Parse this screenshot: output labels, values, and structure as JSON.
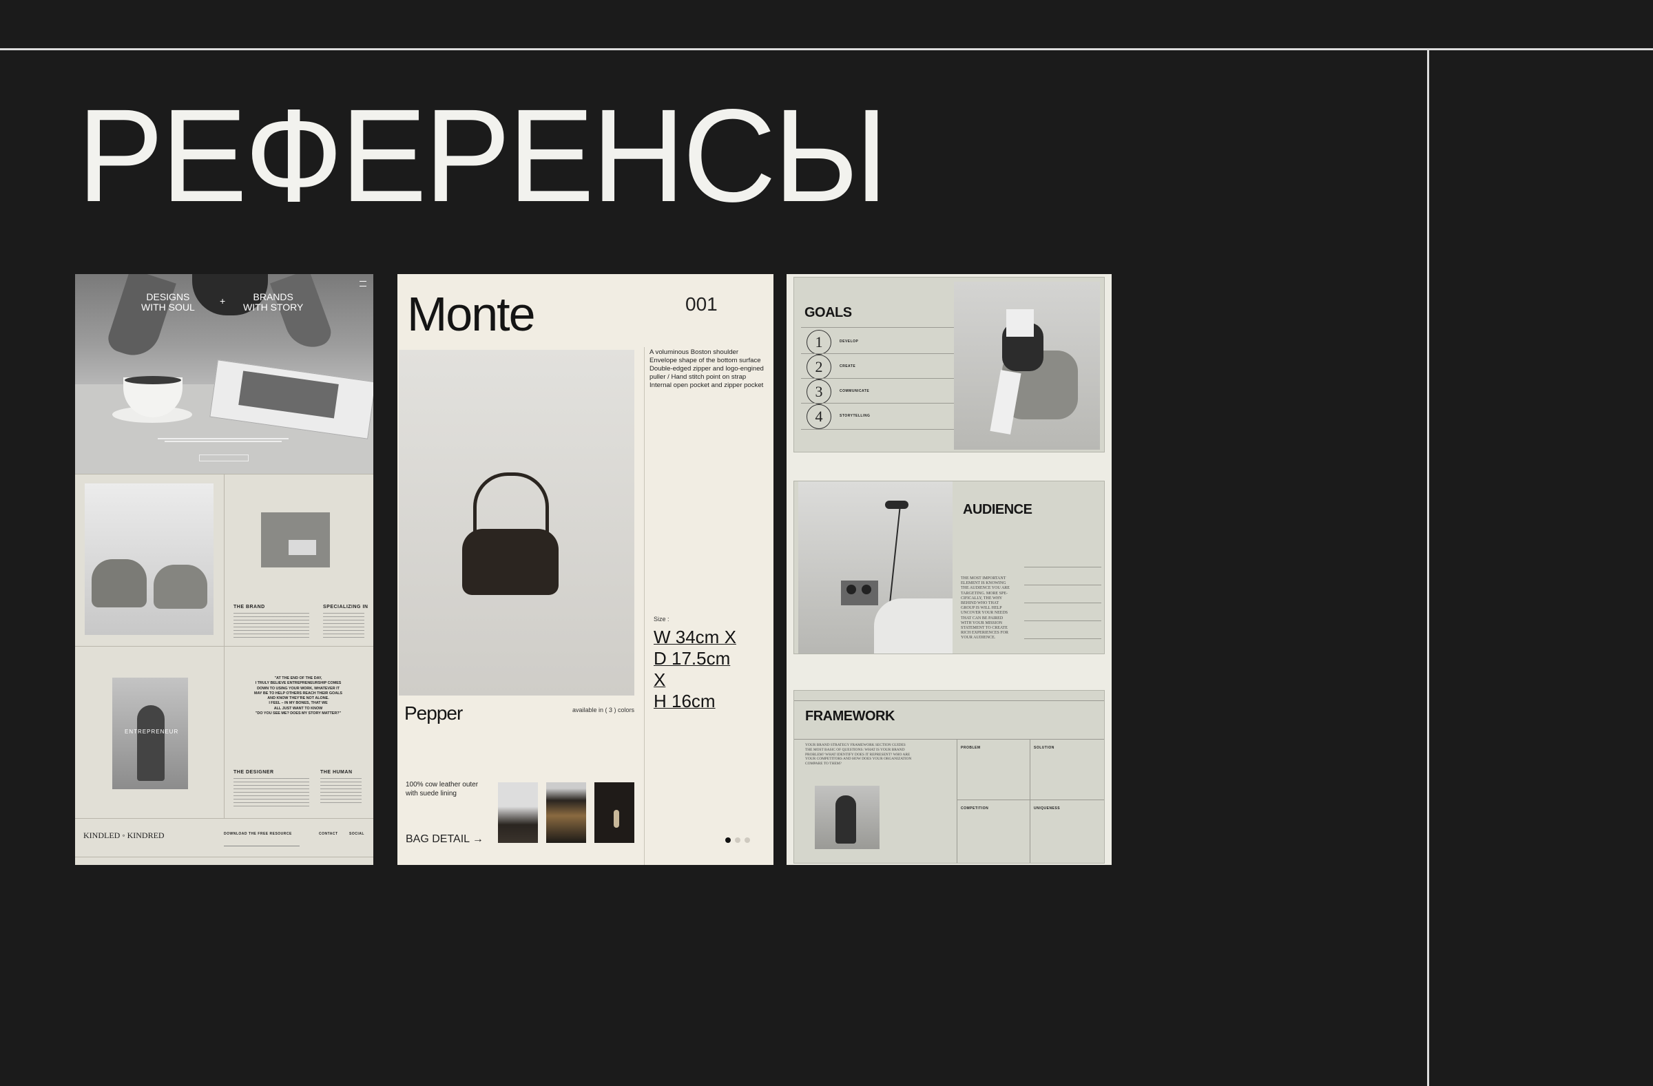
{
  "page": {
    "title": "РЕФЕРЕНСЫ"
  },
  "ref1": {
    "hero_left": "DESIGNS\nWITH SOUL",
    "hero_plus": "+",
    "hero_right": "BRANDS\nWITH STORY",
    "menu_icon": "menu-icon",
    "the_brand": "THE BRAND",
    "specializing_in": "SPECIALIZING IN",
    "quote": "\"AT THE END OF THE DAY,\nI TRULY BELIEVE ENTREPRENEURSHIP COMES\nDOWN TO USING YOUR WORK, WHATEVER IT\nMAY BE TO HELP OTHERS REACH THEIR GOALS\nAND KNOW THEY'RE NOT ALONE.\nI FEEL – IN MY BONES, THAT WE\nALL JUST WANT TO KNOW\n\"DO YOU SEE ME? DOES MY STORY MATTER?\"",
    "the_designer": "THE DESIGNER",
    "the_human": "THE HUMAN",
    "logo": "KINDLED ◦ KINDRED",
    "download": "DOWNLOAD THE FREE RESOURCE",
    "contact": "CONTACT",
    "social": "SOCIAL",
    "entrepreneur": "ENTREPRENEUR"
  },
  "ref2": {
    "brand": "Monte",
    "number": "001",
    "description": "A voluminous Boston shoulder\nEnvelope shape of the bottom surface\nDouble-edged zipper and logo-engined\npuller / Hand stitch point on strap\nInternal open pocket and zipper pocket",
    "size_label": "Size :",
    "size_w": "W 34cm X",
    "size_d": "D 17.5cm",
    "size_x": "X",
    "size_h": "H 16cm",
    "product": "Pepper",
    "availability": "available in ( 3 ) colors",
    "material": "100% cow leather outer\nwith suede lining",
    "cta": "BAG DETAIL →"
  },
  "ref3": {
    "goals_title": "GOALS",
    "goals": [
      {
        "num": "1",
        "label": "DEVELOP"
      },
      {
        "num": "2",
        "label": "CREATE"
      },
      {
        "num": "3",
        "label": "COMMUNICATE"
      },
      {
        "num": "4",
        "label": "STORYTELLING"
      }
    ],
    "audience_title": "AUDIENCE",
    "audience_text": "THE MOST IMPORTANT\nELEMENT IS KNOWING\nTHE AUDIENCE YOU ARE\nTARGETING. MORE SPE-\nCIFICALLY, THE WHY\nBEHIND WHO THAT\nGROUP IS WILL HELP\nUNCOVER YOUR NEEDS\nTHAT CAN BE PAIRED\nWITH YOUR MISSION\nSTATEMENT TO CREATE\nRICH EXPERIENCES FOR\nYOUR AUDIENCE.",
    "framework_title": "FRAMEWORK",
    "framework_text": "YOUR BRAND STRATEGY FRAMEWORK SECTION GUIDES\nTHE MOST BASIC OF QUESTIONS: WHAT IS YOUR BRAND\nPROBLEM? WHAT IDENTIFY DOES IT REPRESENT? WHO ARE\nYOUR COMPETITORS AND HOW DOES YOUR ORGANIZATION\nCOMPARE TO THEM?",
    "problem": "PROBLEM",
    "solution": "SOLUTION",
    "competition": "COMPETITION",
    "uniqueness": "UNIQUENESS"
  }
}
